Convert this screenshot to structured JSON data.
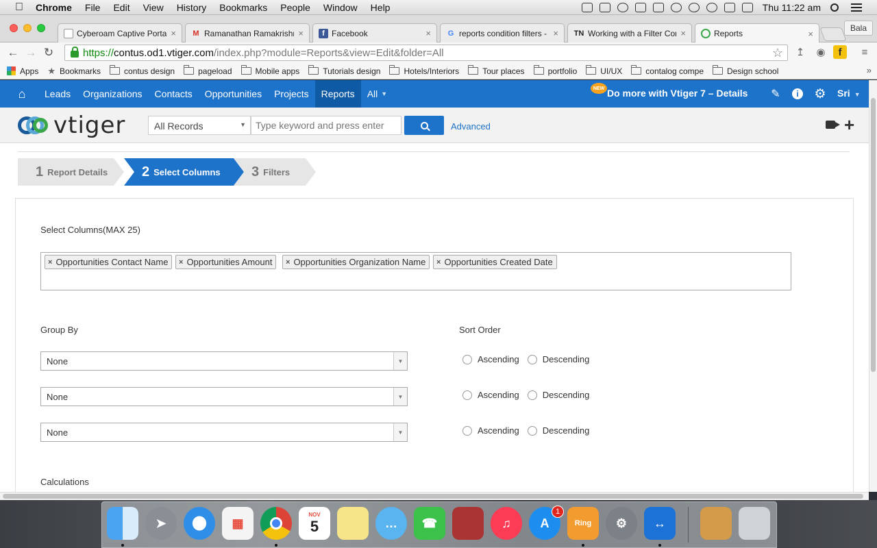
{
  "macbar": {
    "app": "Chrome",
    "menus": [
      "File",
      "Edit",
      "View",
      "History",
      "Bookmarks",
      "People",
      "Window",
      "Help"
    ],
    "clock": "Thu 11:22 am"
  },
  "tabs": [
    {
      "title": "Cyberoam Captive Portal",
      "favicon": "page-icon"
    },
    {
      "title": "Ramanathan Ramakrishnan",
      "favicon": "gmail-icon"
    },
    {
      "title": "Facebook",
      "favicon": "facebook-icon"
    },
    {
      "title": "reports condition filters -",
      "favicon": "google-icon"
    },
    {
      "title": "Working with a Filter Con",
      "favicon": "tn-icon"
    },
    {
      "title": "Reports",
      "favicon": "vtiger-icon"
    }
  ],
  "profile": "Bala",
  "address": {
    "https": "https://",
    "host": "contus.od1.vtiger.com",
    "path": "/index.php?module=Reports&view=Edit&folder=All"
  },
  "bookmarks": [
    "Apps",
    "Bookmarks",
    "contus design",
    "pageload",
    "Mobile apps",
    "Tutorials design",
    "Hotels/Interiors",
    "Tour places",
    "portfolio",
    "UI/UX",
    "contalog compe",
    "Design school"
  ],
  "vnav": {
    "items": [
      "Leads",
      "Organizations",
      "Contacts",
      "Opportunities",
      "Projects",
      "Reports",
      "All"
    ],
    "active": "Reports",
    "badge": "NEW",
    "promo": "Do more with Vtiger 7 – Details",
    "user": "Sri"
  },
  "header": {
    "logo": "vtiger",
    "record_filter": "All Records",
    "search_placeholder": "Type keyword and press enter",
    "advanced": "Advanced"
  },
  "steps": [
    {
      "num": "1",
      "label": "Report Details"
    },
    {
      "num": "2",
      "label": "Select Columns"
    },
    {
      "num": "3",
      "label": "Filters"
    }
  ],
  "form": {
    "select_columns_label": "Select Columns(MAX 25)",
    "columns": [
      "Opportunities Contact Name",
      "Opportunities Amount",
      "Opportunities Organization Name",
      "Opportunities Created Date"
    ],
    "group_by_label": "Group By",
    "sort_order_label": "Sort Order",
    "group_by": [
      "None",
      "None",
      "None"
    ],
    "ascending": "Ascending",
    "descending": "Descending",
    "calculations_label": "Calculations"
  },
  "dock": {
    "calendar_month": "NOV",
    "calendar_day": "5",
    "appstore_badge": "1",
    "ring_label": "Ring"
  }
}
